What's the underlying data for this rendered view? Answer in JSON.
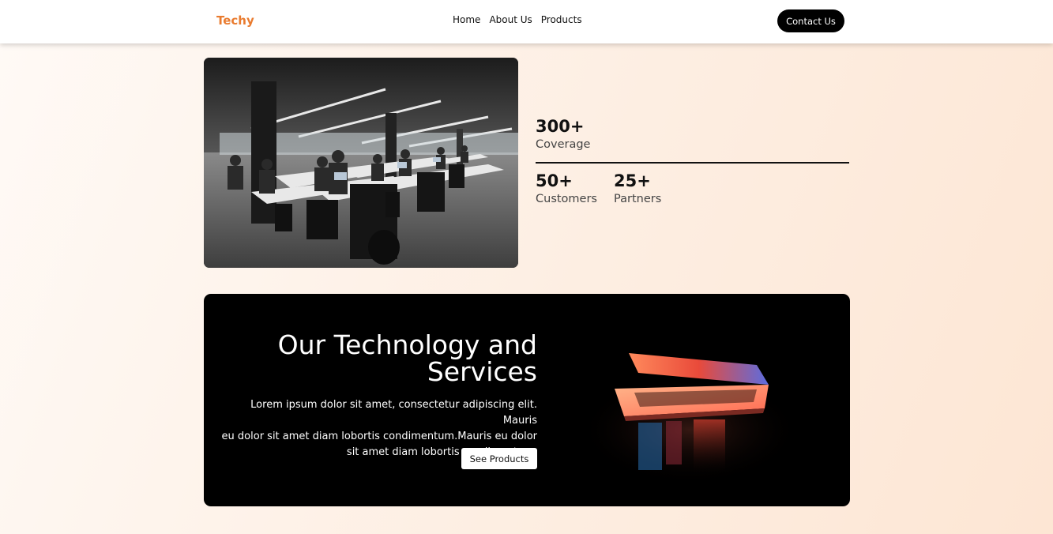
{
  "nav": {
    "brand": "Techy",
    "links": [
      "Home",
      "About Us",
      "Products"
    ],
    "cta": "Contact Us"
  },
  "colors": {
    "brand": "#e97b2f",
    "dark": "#000000",
    "background": "#fdeee2"
  },
  "stats": {
    "coverage": {
      "value": "300+",
      "label": "Coverage"
    },
    "customers": {
      "value": "50+",
      "label": "Customers"
    },
    "partners": {
      "value": "25+",
      "label": "Partners"
    }
  },
  "services": {
    "title_line1": "Our Technology and",
    "title_line2": "Services",
    "body_line1": "Lorem ipsum dolor sit amet, consectetur adipiscing elit. Mauris",
    "body_line2": "eu dolor sit amet diam lobortis condimentum.Mauris eu dolor",
    "body_line3": "sit amet diam lobortis condimentum.",
    "button": "See Products"
  },
  "images": {
    "office_photo": "office-photo",
    "laptop_photo": "laptop-photo"
  }
}
